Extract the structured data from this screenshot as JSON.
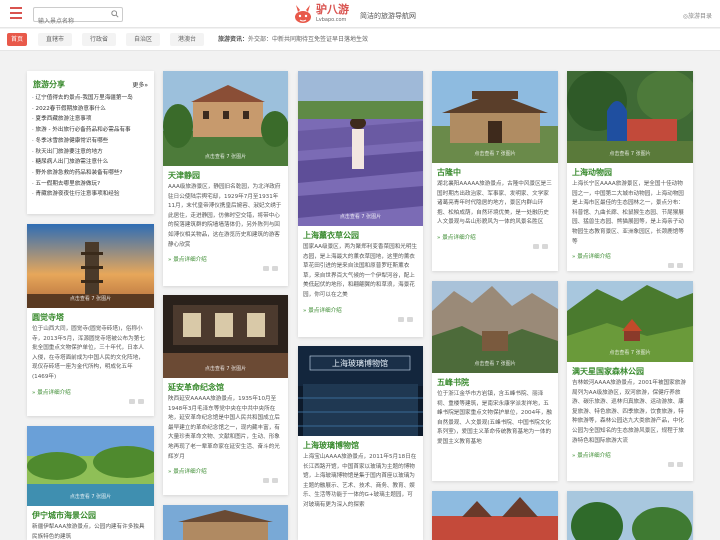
{
  "header": {
    "search_placeholder": "输入景点名称",
    "logo_text": "驴八游",
    "logo_url": "Lvbapo.com",
    "slogan": "简洁的旅游导航网",
    "lang": "◎旅游目录"
  },
  "nav": {
    "home": "首页",
    "items": [
      "直辖市",
      "行政省",
      "自治区",
      "港澳台"
    ],
    "news_label": "旅游资讯：",
    "news_text": "外交部：中新共同期待互免签证早日落地生效"
  },
  "share": {
    "title": "旅游分享",
    "more": "更多»",
    "items": [
      "· 辽宁值得去的景点-我国万里海疆第一岛",
      "· 2022春节假期旅游意事什么",
      "· 夏季西藏旅游注意事项",
      "· 旅游 - 外出旅行必备药品和必需品有事",
      "· 冬季冰雪旅游健康常识有哪些",
      "· 秋天出门旅游要注意的地方",
      "· 糖尿病人出门旅游需注意什么",
      "· 野外旅游急救的药品和装备有哪些?",
      "· 五一假期去哪里旅游做玩?",
      "· 青藏旅游夜夜住行注意事项和经验"
    ]
  },
  "caption": "点击查看 7 张图片",
  "more_label": "» 景点详细介绍",
  "cards": {
    "c2": {
      "title": "天津静园",
      "desc": "AAA级旅游景区，静园旧名乾园，为北洋政府驻日公使陆宗舆宅邸，1929年7月至1931年11月，末代皇帝溥仪携皇后婉容、淑妃文绣于此居住，走进静园，仿佛时空交错，将带中心的院落建筑群的院墙墙落体仍，另外陈列与回如溥仪相关物品，这在游览历史和建筑的游客静心欣赏"
    },
    "c3": {
      "title": "上海薰衣草公园",
      "desc": "国家AA级景区，两为聚郑利变香菜园和光明生态园，是上海最大的薰衣草园地，这里的薰衣草花田引进的是来自法国和原普罗旺斯薰衣草，来自世界百大气候的一个伊犁河谷，配上美低起伏的地形，和翩翩翼的和草浪，海景花园，你可以在之美"
    },
    "c4": {
      "title": "古隆中",
      "desc": "湖北襄阳AAAAA旅游景点，古隆中风景区是三国时期杰出政治家、军事家、发明家、文学家诸葛亮青年时代隐居的地方，景区内群山环抱、松柏成荫，自然环境优美，是一处融历史人文景观与岳山形貌风为一体的风景名胜区"
    },
    "c5": {
      "title": "上海动物园",
      "desc": "上海长宁区AAAA旅游景区，是全国十佳动物园之一，中国第二大城市动物园，上海动物园是上海市区最佳的生态园林之一，景点分布：科普馆、九曲长廊、松鼠猴生态园、节尾猴展园、猛兽生态园、熊猫展园等，是上海亲子动物园生态教育景区、亚洲象园区，长颈鹿馆等等"
    },
    "c6": {
      "title": "圆觉寺塔",
      "desc": "位于山西大同，圆觉寺(圆觉寺砖塔)，俗称小寺，2013年5月，浑源圆觉寺塔被公布为第七批全国重点文物保护单位，三十年代，日本人入侵，在寺塔面前成为中国人民的文化阵地，现仅存砖塔一座为金代所构，明成化五年(1469年)"
    },
    "c7": {
      "title": "延安革命纪念馆",
      "desc": "陕西延安AAAAA旅游景点，1935年10月至1948年3月毛泽东等党中央在中共中央所在地，延安革命纪念馆是中国人民共和国成立后最早建立的革命纪念馆之一，现内藏丰富，有大量珍贵革命文物、文献和图片，生动、形象地再现了老一辈革命家在延安生活、奋斗的光辉岁月"
    },
    "c8": {
      "title": "上海玻璃博物馆",
      "desc": "上海宝山AAAA旅游景点，2011年5月18日在长江西路开馆，中国首家以玻璃为主题的博物馆，上海玻璃博物馆是集于国内首座以玻璃为主题的融展示、艺术、技术、商务、教育、娱乐、生活等功能于一体的G+玻璃主题园，可对玻璃有更为深入的探索"
    },
    "c9": {
      "title": "五峰书院",
      "desc": "位于浙江金华市方岩镇，含五峰书院、丽泽祠、重楼等建筑，是南宋永康学派发祥地，五峰书院是国家重点文物保护单位，2004年，融自然景观、人文景观(五峰书院、中国书院文化系列室)，爱国主义革命传统教育基地为一体的爱国主义教育基地"
    },
    "c10": {
      "title": "满天星国家森林公园",
      "desc": "吉林蛟河AAAA旅游景点，2001年被国家旅游局列为AA级旅游区，双河旅游，保健疗养旅游、碳乐旅游、巡林归真旅游、运动游旅、康复旅游、特色旅游、四季旅游，饮食旅游，特种旅游等，森林公园达九大类旅游产品，中化公园为全国知名的生态旅游风景区，规程于旅游特色和国际旅游大流"
    },
    "c11": {
      "title": "伊宁城市海景公园",
      "desc": "新疆伊犁AAA旅游景点，公园内建有许多独具民族特色的建筑"
    }
  }
}
